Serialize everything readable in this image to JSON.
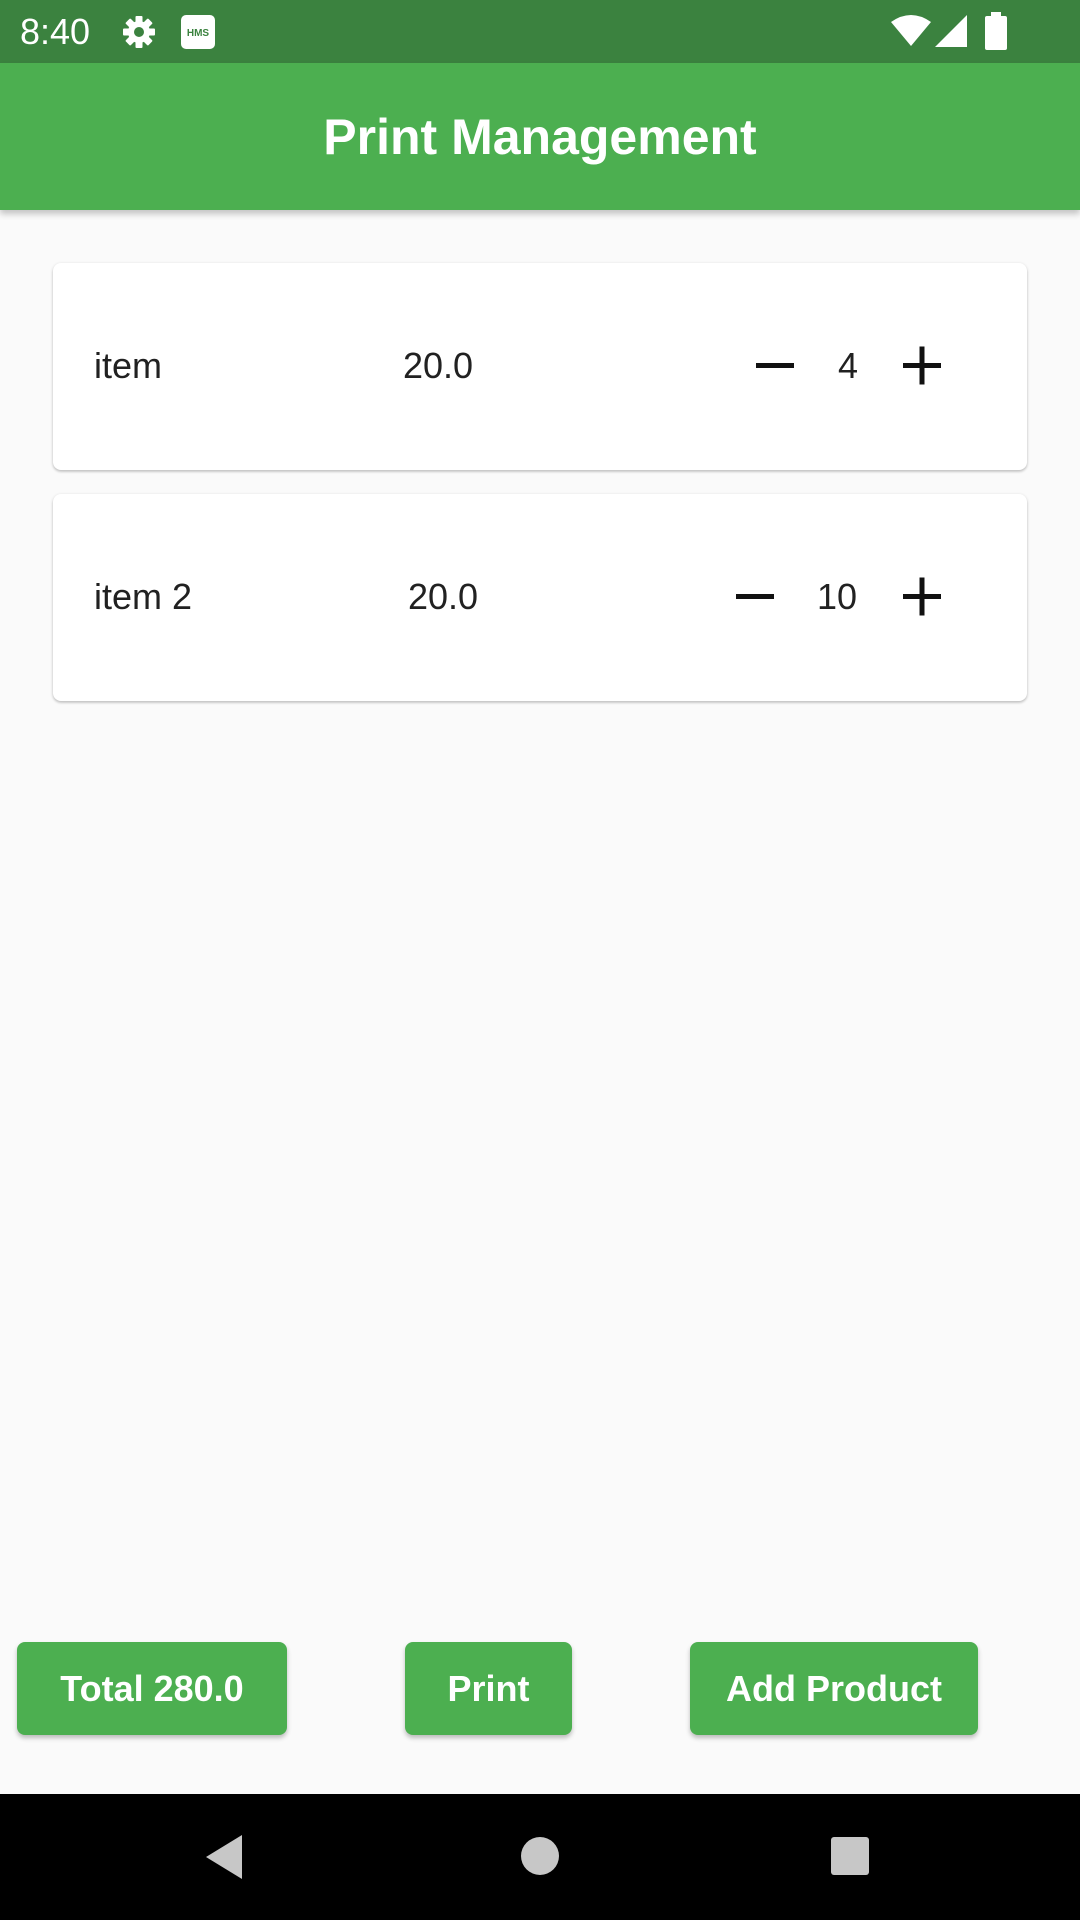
{
  "status_bar": {
    "time": "8:40",
    "icons": [
      "gear-icon",
      "hms-icon",
      "wifi-icon",
      "cell-signal-icon",
      "battery-icon"
    ],
    "hms_label": "HMS"
  },
  "app_bar": {
    "title": "Print Management",
    "color": "#4caf50"
  },
  "items": [
    {
      "name": "item",
      "price": "20.0",
      "quantity": "4"
    },
    {
      "name": "item 2",
      "price": "20.0",
      "quantity": "10"
    }
  ],
  "actions": {
    "total_label": "Total 280.0",
    "print_label": "Print",
    "add_product_label": "Add Product"
  },
  "nav_bar": {
    "icons": [
      "back-icon",
      "home-icon",
      "recents-icon"
    ]
  },
  "colors": {
    "accent": "#4caf50",
    "status_bar": "#3b823f",
    "background": "#fafafa"
  }
}
